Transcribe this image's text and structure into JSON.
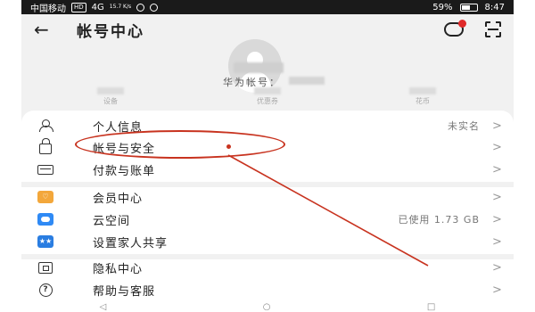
{
  "status_bar": {
    "carrier": "中国移动",
    "hd": "HD",
    "network": "4G",
    "speed": "15.7 K/s",
    "battery": "59%",
    "time": "8:47"
  },
  "header": {
    "title": "帐号中心"
  },
  "profile": {
    "account_label": "华为帐号："
  },
  "stats": [
    {
      "label": "设备"
    },
    {
      "label": "优惠券"
    },
    {
      "label": "花币"
    }
  ],
  "menu": [
    {
      "icon": "person-icon",
      "label": "个人信息",
      "value": "未实名"
    },
    {
      "icon": "lock-icon",
      "label": "帐号与安全",
      "value": ""
    },
    {
      "icon": "card-icon",
      "label": "付款与账单",
      "value": ""
    },
    {
      "icon": "vip-icon",
      "label": "会员中心",
      "value": ""
    },
    {
      "icon": "cloud-icon",
      "label": "云空间",
      "value": "已使用 1.73 GB"
    },
    {
      "icon": "family-icon",
      "label": "设置家人共享",
      "value": ""
    },
    {
      "icon": "privacy-icon",
      "label": "隐私中心",
      "value": ""
    },
    {
      "icon": "help-icon",
      "label": "帮助与客服",
      "value": ""
    }
  ],
  "colors": {
    "annotation": "#c8331f",
    "badge": "#e02a2a",
    "vip": "#f3a73b",
    "cloud": "#2f8af5"
  },
  "chevron": ">",
  "back_arrow": "←",
  "nav": {
    "back": "◁",
    "home": "○",
    "recent": "□"
  }
}
